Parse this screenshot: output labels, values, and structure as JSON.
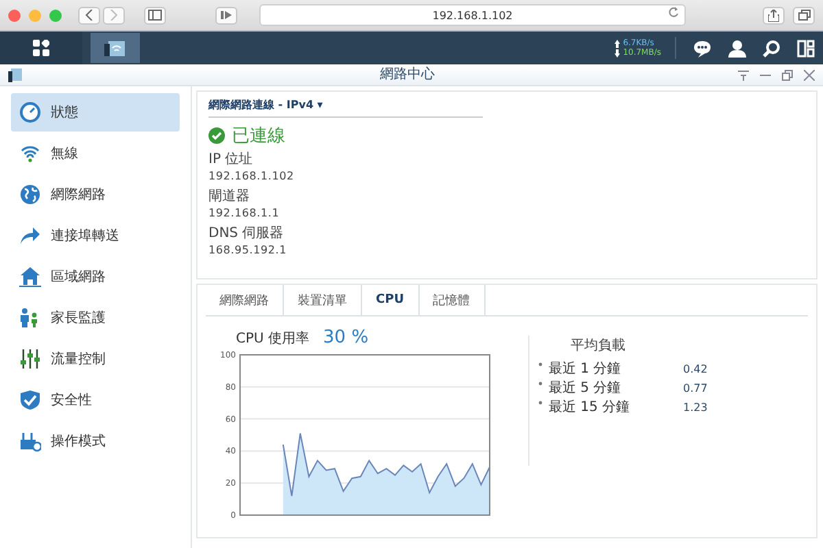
{
  "browser": {
    "address": "192.168.1.102"
  },
  "taskbar": {
    "upload_speed": "6.7KB/s",
    "download_speed": "10.7MB/s"
  },
  "window": {
    "title": "網路中心"
  },
  "sidebar": {
    "items": [
      {
        "label": "狀態",
        "selected": true,
        "kind": "gauge"
      },
      {
        "label": "無線",
        "selected": false,
        "kind": "wifi"
      },
      {
        "label": "網際網路",
        "selected": false,
        "kind": "globe"
      },
      {
        "label": "連接埠轉送",
        "selected": false,
        "kind": "arrow"
      },
      {
        "label": "區域網路",
        "selected": false,
        "kind": "home"
      },
      {
        "label": "家長監護",
        "selected": false,
        "kind": "family"
      },
      {
        "label": "流量控制",
        "selected": false,
        "kind": "sliders"
      },
      {
        "label": "安全性",
        "selected": false,
        "kind": "shield"
      },
      {
        "label": "操作模式",
        "selected": false,
        "kind": "router"
      }
    ]
  },
  "connection": {
    "title": "網際網路連線 - IPv4",
    "caret": "▾",
    "status": "已連線",
    "fields": [
      {
        "label": "IP 位址",
        "value": "192.168.1.102"
      },
      {
        "label": "閘道器",
        "value": "192.168.1.1"
      },
      {
        "label": "DNS 伺服器",
        "value": "168.95.192.1"
      }
    ]
  },
  "tabs": [
    {
      "label": "網際網路",
      "selected": false
    },
    {
      "label": "裝置清單",
      "selected": false
    },
    {
      "label": "CPU",
      "selected": true
    },
    {
      "label": "記憶體",
      "selected": false
    }
  ],
  "cpu": {
    "label": "CPU 使用率",
    "value": "30 %",
    "chart_data": {
      "type": "area",
      "grid": true,
      "ylim": [
        0,
        100
      ],
      "yticks": [
        0,
        20,
        40,
        60,
        80,
        100
      ],
      "values": [
        null,
        null,
        null,
        null,
        null,
        44,
        12,
        51,
        24,
        34,
        28,
        29,
        15,
        23,
        24,
        34,
        26,
        29,
        25,
        31,
        27,
        32,
        14,
        24,
        32,
        18,
        23,
        32,
        19,
        30
      ]
    }
  },
  "load": {
    "title": "平均負載",
    "rows": [
      {
        "label": "最近 1 分鐘",
        "value": "0.42"
      },
      {
        "label": "最近 5 分鐘",
        "value": "0.77"
      },
      {
        "label": "最近 15 分鐘",
        "value": "1.23"
      }
    ]
  }
}
